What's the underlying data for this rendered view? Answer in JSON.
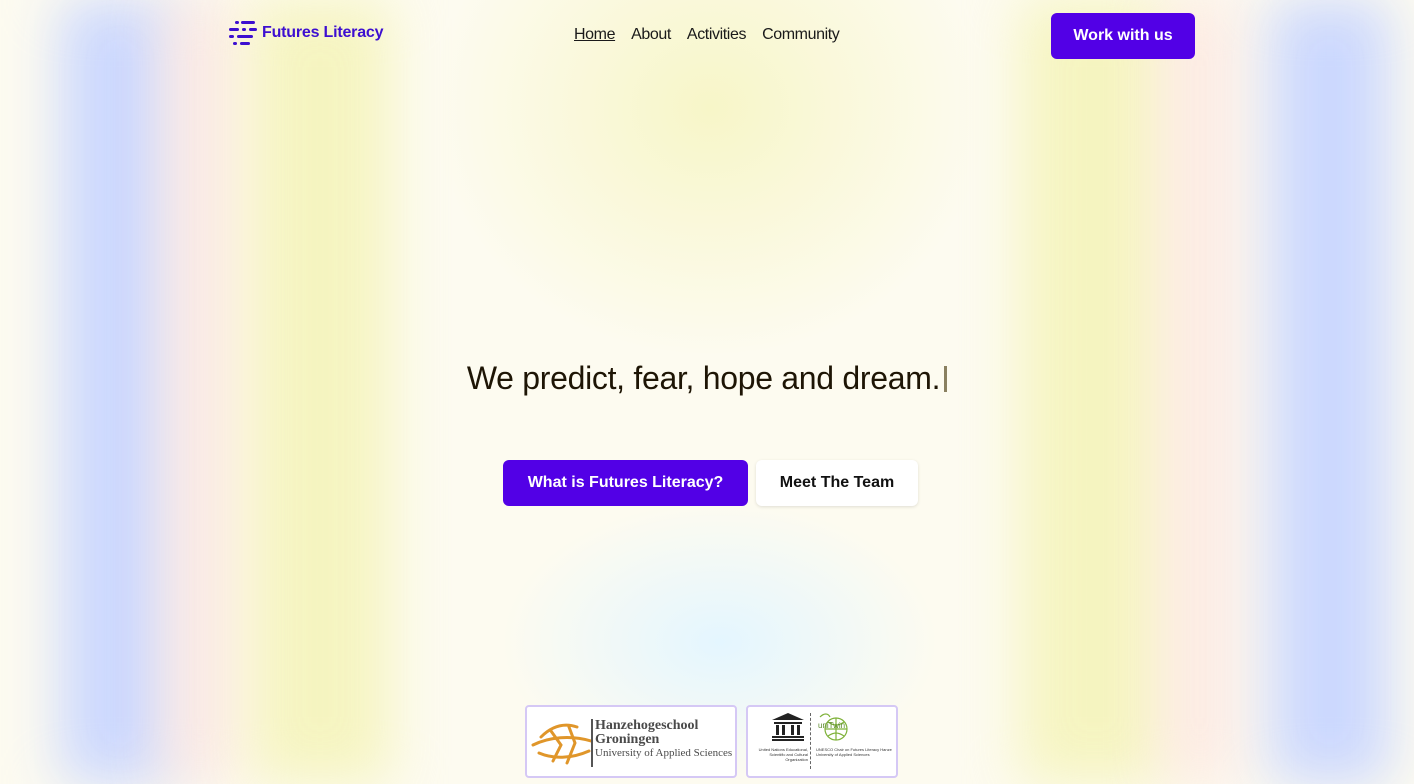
{
  "brand": {
    "name": "Futures Literacy",
    "color": "#3d0fd0"
  },
  "nav": {
    "items": [
      {
        "label": "Home",
        "active": true
      },
      {
        "label": "About",
        "active": false
      },
      {
        "label": "Activities",
        "active": false
      },
      {
        "label": "Community",
        "active": false
      }
    ],
    "cta_label": "Work with us"
  },
  "hero": {
    "headline": "We predict, fear, hope and dream.",
    "primary_label": "What is Futures Literacy?",
    "secondary_label": "Meet The Team"
  },
  "partners": {
    "hanze": {
      "line1": "Hanzehogeschool",
      "line2": "Groningen",
      "line3": "University of Applied Sciences"
    },
    "unesco": {
      "org": "United Nations Educational, Scientific and Cultural Organization",
      "chair": "UNESCO Chair on Futures Literacy Hanze University of Applied Sciences",
      "unitwin": "uniTwin"
    }
  },
  "colors": {
    "accent": "#5200e6",
    "heading": "#1e1505"
  }
}
